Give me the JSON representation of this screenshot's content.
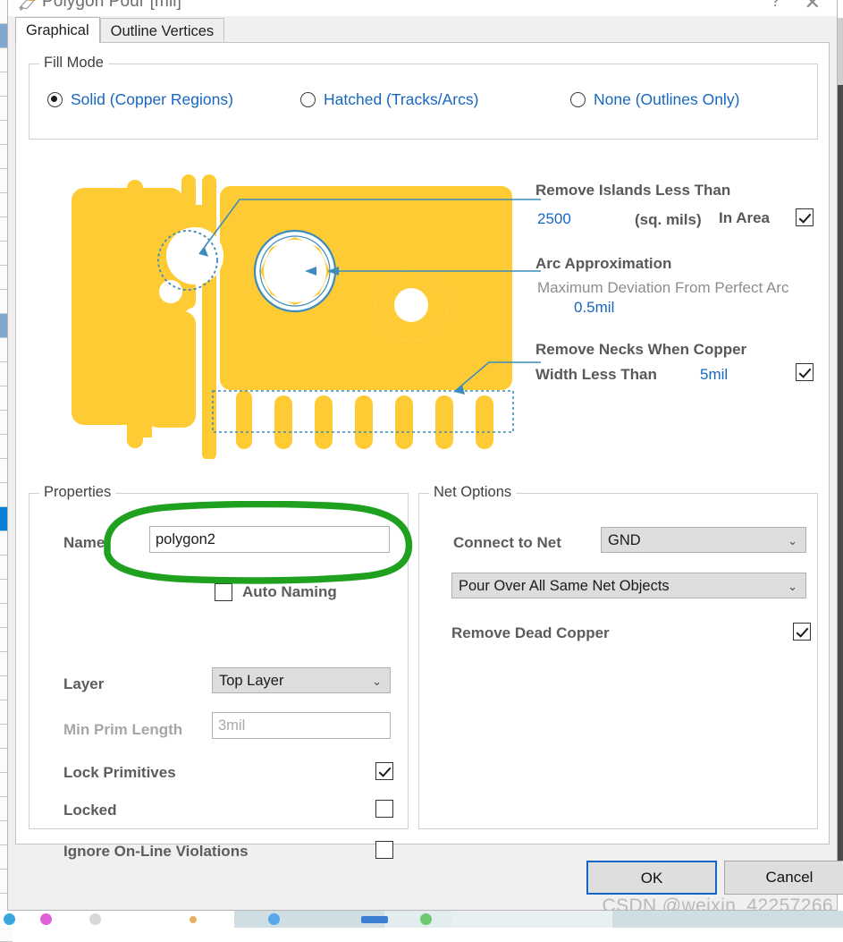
{
  "window": {
    "title": "Polygon Pour [mil]",
    "icon": "polygon-pour-icon",
    "help_label": "?",
    "close_label": "✕"
  },
  "tabs": [
    {
      "label": "Graphical",
      "active": true
    },
    {
      "label": "Outline Vertices",
      "active": false
    }
  ],
  "fill_mode": {
    "group_title": "Fill Mode",
    "options": [
      {
        "label": "Solid (Copper Regions)",
        "checked": true
      },
      {
        "label": "Hatched (Tracks/Arcs)",
        "checked": false
      },
      {
        "label": "None (Outlines Only)",
        "checked": false
      }
    ]
  },
  "graphic_options": {
    "remove_islands_title": "Remove Islands Less Than",
    "remove_islands_value": "2500",
    "remove_islands_units": "(sq. mils)",
    "remove_islands_suffix": "In Area",
    "remove_islands_checked": true,
    "arc_approximation_title": "Arc Approximation",
    "arc_approximation_desc": "Maximum Deviation From Perfect Arc",
    "arc_approximation_value": "0.5mil",
    "remove_necks_title_line1": "Remove Necks When Copper",
    "remove_necks_title_line2": "Width Less Than",
    "remove_necks_value": "5mil",
    "remove_necks_checked": true
  },
  "properties": {
    "group_title": "Properties",
    "name_label": "Name",
    "name_value": "polygon2",
    "auto_naming_label": "Auto Naming",
    "auto_naming_checked": false,
    "layer_label": "Layer",
    "layer_value": "Top Layer",
    "min_prim_length_label": "Min Prim Length",
    "min_prim_length_value": "3mil",
    "lock_primitives_label": "Lock Primitives",
    "lock_primitives_checked": true,
    "locked_label": "Locked",
    "locked_checked": false,
    "ignore_online_label": "Ignore On-Line Violations",
    "ignore_online_checked": false
  },
  "net_options": {
    "group_title": "Net Options",
    "connect_to_net_label": "Connect to Net",
    "connect_to_net_value": "GND",
    "pour_over_value": "Pour Over All Same Net Objects",
    "remove_dead_copper_label": "Remove Dead Copper",
    "remove_dead_copper_checked": true
  },
  "footer": {
    "ok_label": "OK",
    "cancel_label": "Cancel"
  },
  "overlay": {
    "watermark": "CSDN @weixin_42257266",
    "annotation_shape": "green-hand-drawn-ellipse"
  },
  "colors": {
    "copper": "#FFCB34",
    "copper_shadow": "#F5B721",
    "link_blue": "#1767C0",
    "accent_blue": "#3C8DBC",
    "annotation_green": "#1FA01F",
    "label_grey": "#5C5C5C",
    "disabled_grey": "#A6A6A6"
  }
}
